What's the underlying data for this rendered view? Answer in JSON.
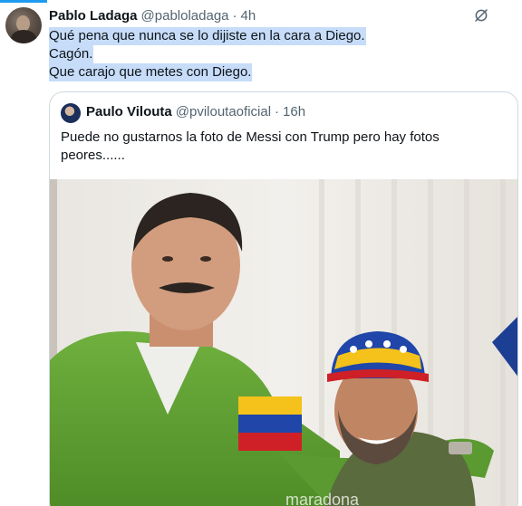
{
  "reply": {
    "author_name": "Pablo Ladaga",
    "author_handle": "@pabloladaga",
    "separator": "·",
    "time": "4h",
    "lines": [
      "Qué pena que nunca se lo dijiste en la cara a Diego.",
      "Cagón.",
      "Que carajo que metes con Diego."
    ]
  },
  "quoted": {
    "author_name": "Paulo Vilouta",
    "author_handle": "@pviloutaoficial",
    "separator": "·",
    "time": "16h",
    "text": "Puede no gustarnos la foto de Messi con Trump pero hay fotos peores......",
    "watermark": "maradona"
  },
  "colors": {
    "accent": "#1d9bf0",
    "highlight": "#c6dcf8",
    "text_secondary": "#536471",
    "border": "#cfd9de"
  },
  "icons": {
    "more": "grok-slash-icon"
  }
}
